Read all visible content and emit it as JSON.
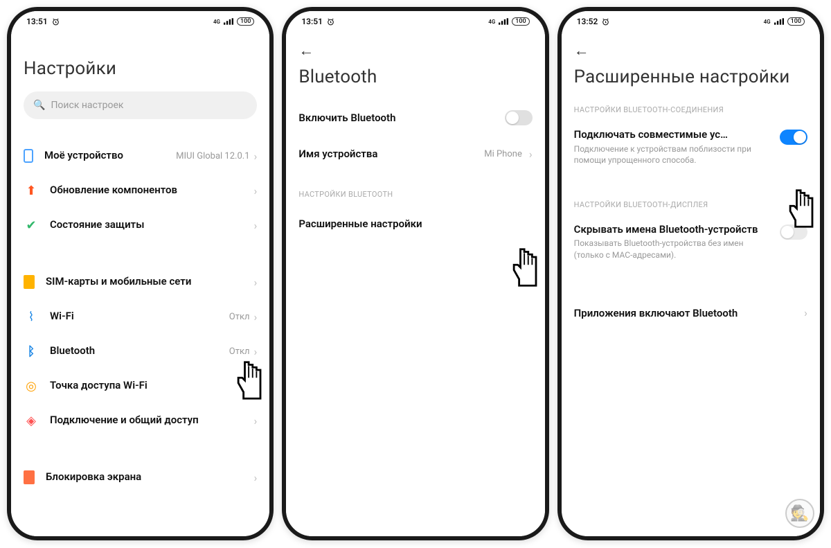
{
  "status": {
    "time1": "13:51",
    "time2": "13:51",
    "time3": "13:52",
    "battery": "100",
    "signal": "4G"
  },
  "p1": {
    "title": "Настройки",
    "search_placeholder": "Поиск настроек",
    "rows": {
      "device": {
        "label": "Моё устройство",
        "value": "MIUI Global 12.0.1"
      },
      "update": {
        "label": "Обновление компонентов"
      },
      "security": {
        "label": "Состояние защиты"
      },
      "sim": {
        "label": "SIM-карты и мобильные сети"
      },
      "wifi": {
        "label": "Wi-Fi",
        "value": "Откл"
      },
      "bt": {
        "label": "Bluetooth",
        "value": "Откл"
      },
      "hotspot": {
        "label": "Точка доступа Wi-Fi"
      },
      "share": {
        "label": "Подключение и общий доступ"
      },
      "lock": {
        "label": "Блокировка экрана"
      }
    }
  },
  "p2": {
    "title": "Bluetooth",
    "enable": "Включить Bluetooth",
    "devname": {
      "label": "Имя устройства",
      "value": "Mi Phone"
    },
    "section": "НАСТРОЙКИ BLUETOOTH",
    "advanced": "Расширенные настройки"
  },
  "p3": {
    "title": "Расширенные настройки",
    "sec1": "НАСТРОЙКИ BLUETOOTH-СОЕДИНЕНИЯ",
    "compat": {
      "title": "Подключать совместимые ус…",
      "desc": "Подключение к устройствам поблизости при помощи упрощенного способа."
    },
    "sec2": "НАСТРОЙКИ BLUETOOTH-ДИСПЛЕЯ",
    "hide": {
      "title": "Скрывать имена Bluetooth-устройств",
      "desc": "Показывать Bluetooth-устройства без имен (только с MAC-адресами)."
    },
    "apps": "Приложения включают Bluetooth"
  }
}
